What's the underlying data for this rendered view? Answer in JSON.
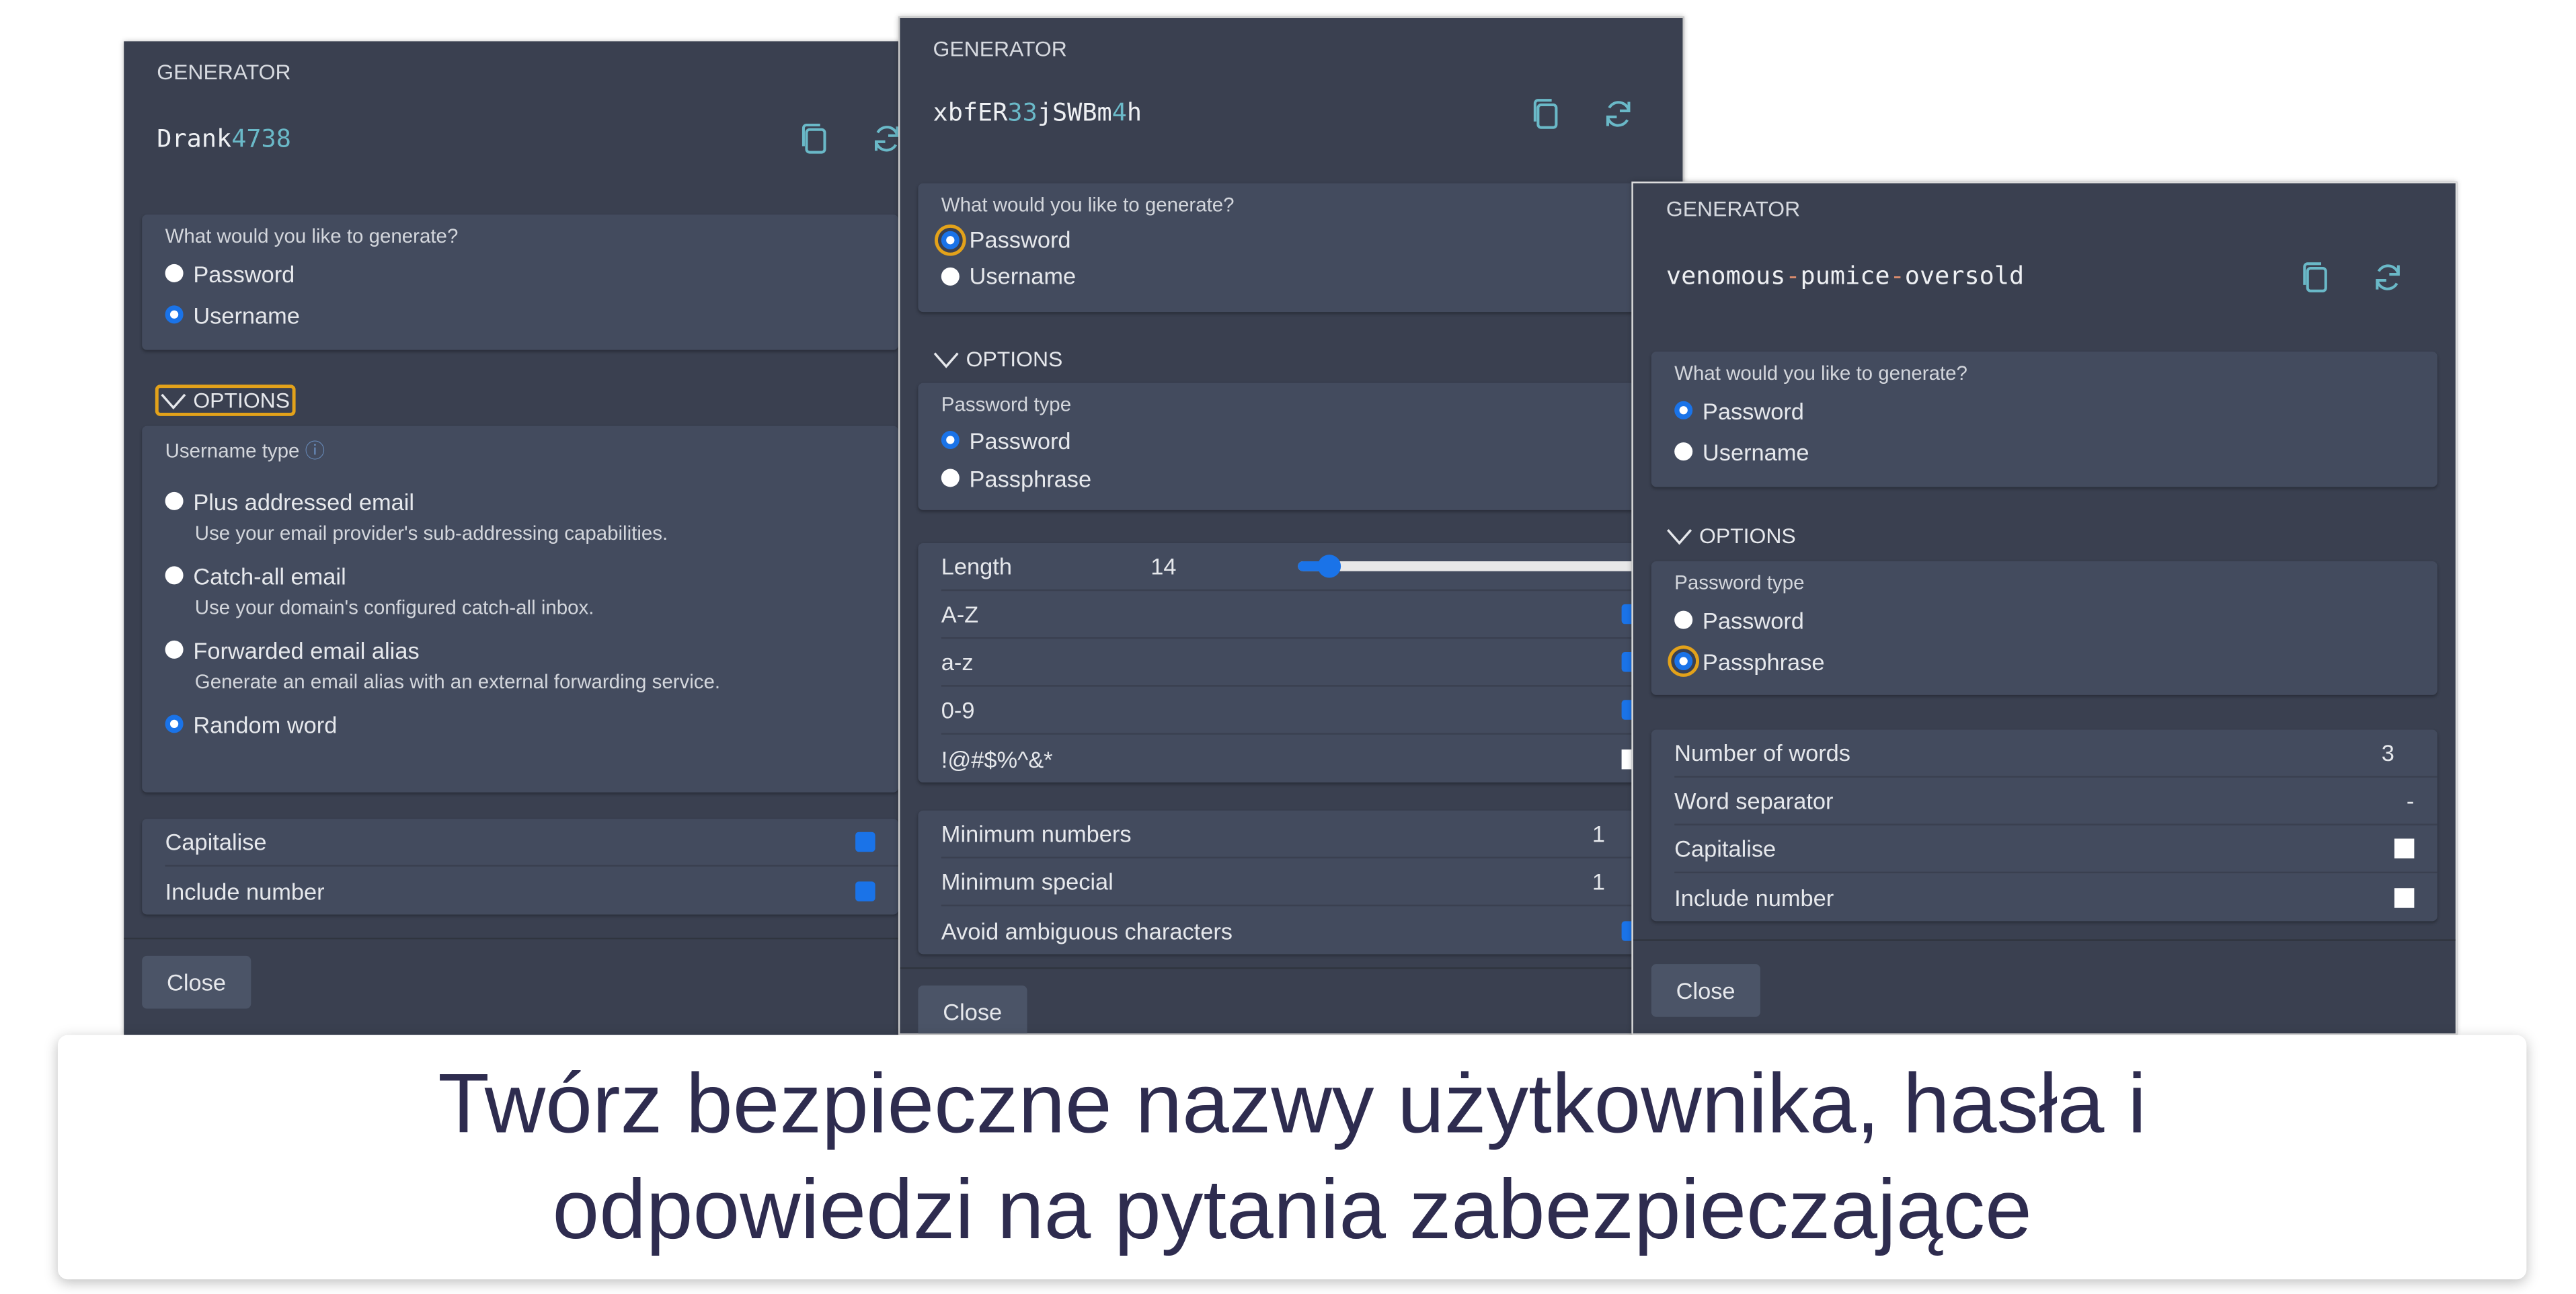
{
  "colors": {
    "accent": "#1a73e8",
    "focus": "#e3a21a",
    "digit": "#6ab9c8",
    "panel": "#3a4050",
    "section": "#434b5e"
  },
  "icons": {
    "copy": "copy-icon",
    "refresh": "refresh-icon",
    "chevron": "chevron-down-icon",
    "help": "help-circle-icon"
  },
  "p1": {
    "header": "GENERATOR",
    "value_a": "Drank",
    "value_b": "4738",
    "question": "What would you like to generate?",
    "r1": "Password",
    "r2": "Username",
    "options": "OPTIONS",
    "type_label": "Username type",
    "types": [
      {
        "label": "Plus addressed email",
        "desc": "Use your email provider's sub-addressing capabilities."
      },
      {
        "label": "Catch-all email",
        "desc": "Use your domain's configured catch-all inbox."
      },
      {
        "label": "Forwarded email alias",
        "desc": "Generate an email alias with an external forwarding service."
      },
      {
        "label": "Random word"
      }
    ],
    "capitalise": "Capitalise",
    "include_number": "Include number",
    "close": "Close"
  },
  "p2": {
    "header": "GENERATOR",
    "v1": "xbfER",
    "v2": "33",
    "v3": "jSWBm",
    "v4": "4",
    "v5": "h",
    "question": "What would you like to generate?",
    "r1": "Password",
    "r2": "Username",
    "options": "OPTIONS",
    "type_label": "Password type",
    "t1": "Password",
    "t2": "Passphrase",
    "length_label": "Length",
    "length": "14",
    "length_min": 5,
    "length_max": 128,
    "az": "A-Z",
    "az_lower": "a-z",
    "digits": "0-9",
    "special": "!@#$%^&*",
    "min_numbers": "Minimum numbers",
    "min_numbers_val": "1",
    "min_special": "Minimum special",
    "min_special_val": "1",
    "avoid": "Avoid ambiguous characters",
    "close": "Close"
  },
  "p3": {
    "header": "GENERATOR",
    "w1": "venomous",
    "sep1": "-",
    "w2": "pumice",
    "sep2": "-",
    "w3": "oversold",
    "question": "What would you like to generate?",
    "r1": "Password",
    "r2": "Username",
    "options": "OPTIONS",
    "type_label": "Password type",
    "t1": "Password",
    "t2": "Passphrase",
    "words_label": "Number of words",
    "words": "3",
    "sep_label": "Word separator",
    "sep": "-",
    "capitalise": "Capitalise",
    "include_number": "Include number",
    "close": "Close"
  },
  "caption": {
    "line1": "Twórz bezpieczne nazwy użytkownika, hasła i",
    "line2": "odpowiedzi na pytania zabezpieczające"
  }
}
